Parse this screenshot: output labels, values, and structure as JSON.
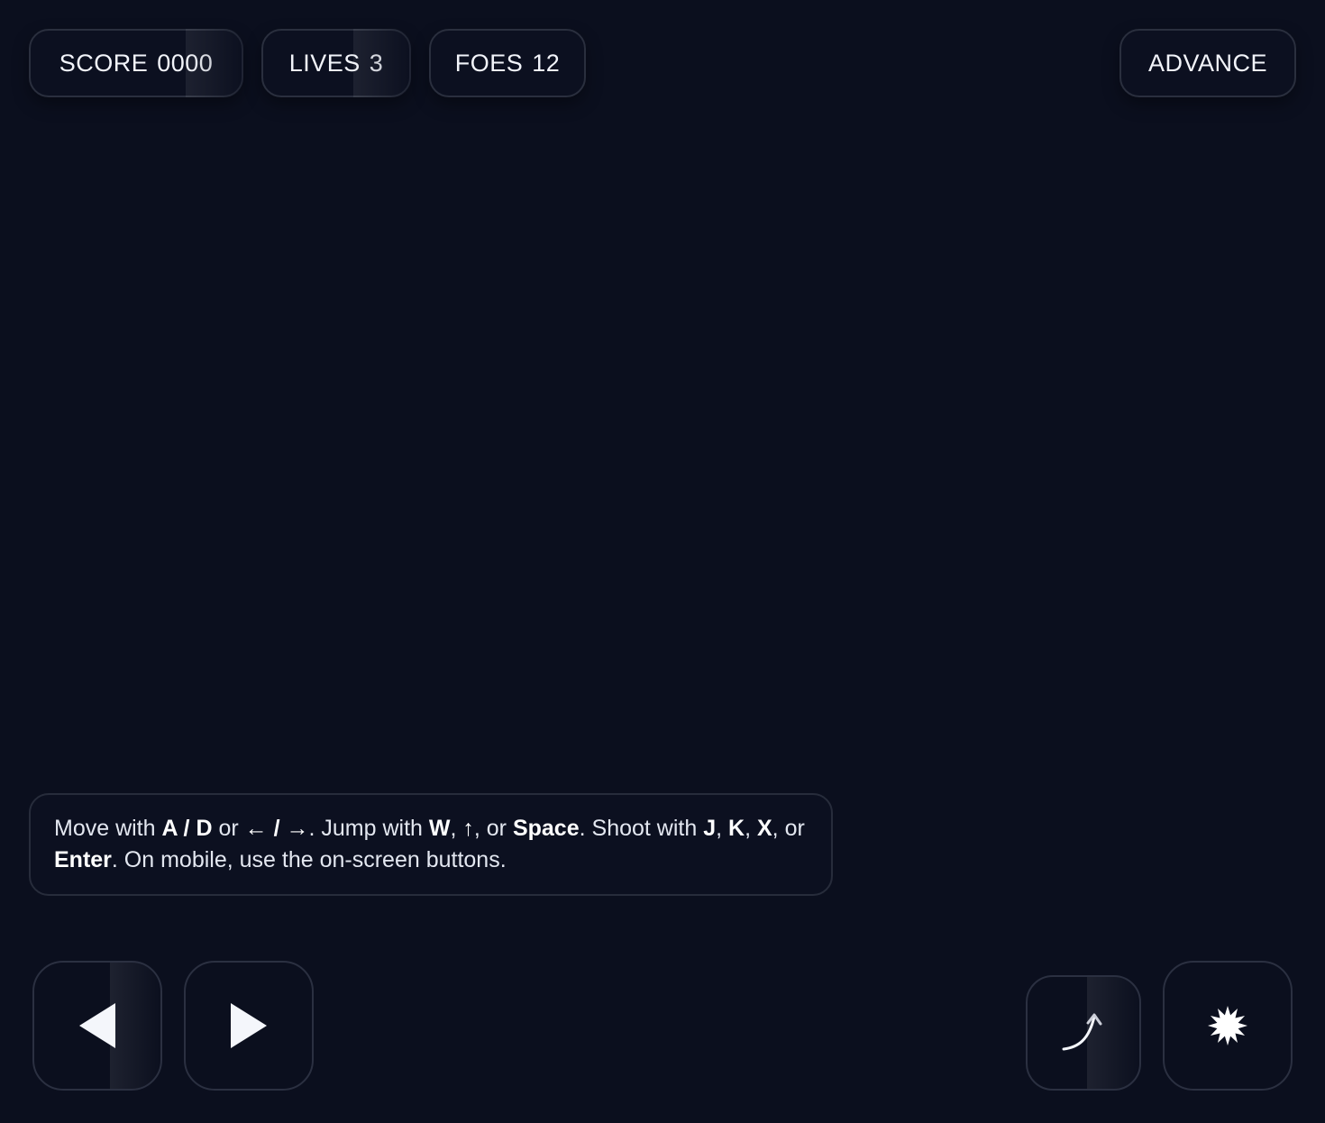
{
  "hud": {
    "score_label": "SCORE",
    "score_value": "0000",
    "lives_label": "LIVES",
    "lives_value": "3",
    "foes_label": "FOES",
    "foes_value": "12",
    "advance_label": "ADVANCE"
  },
  "help": {
    "t1": "Move with ",
    "k1": "A / D",
    "t2": " or ",
    "k2": "← / →",
    "t3": ". Jump with ",
    "k3": "W",
    "t4": ", ",
    "k4": "↑",
    "t5": ", or ",
    "k5": "Space",
    "t6": ". Shoot with ",
    "k6": "J",
    "t7": ", ",
    "k7": "K",
    "t8": ", ",
    "k8": "X",
    "t9": ", or ",
    "k9": "Enter",
    "t10": ". On mobile, use the on-screen buttons."
  },
  "controls": {
    "left_icon": "left-triangle-icon",
    "right_icon": "right-triangle-icon",
    "jump_icon": "jump-arc-arrow-icon",
    "shoot_icon": "burst-star-icon"
  },
  "colors": {
    "background": "#0b0f1e",
    "panel": "#0c1020",
    "border": "#2a2f3e",
    "text": "#f2f4fa"
  }
}
